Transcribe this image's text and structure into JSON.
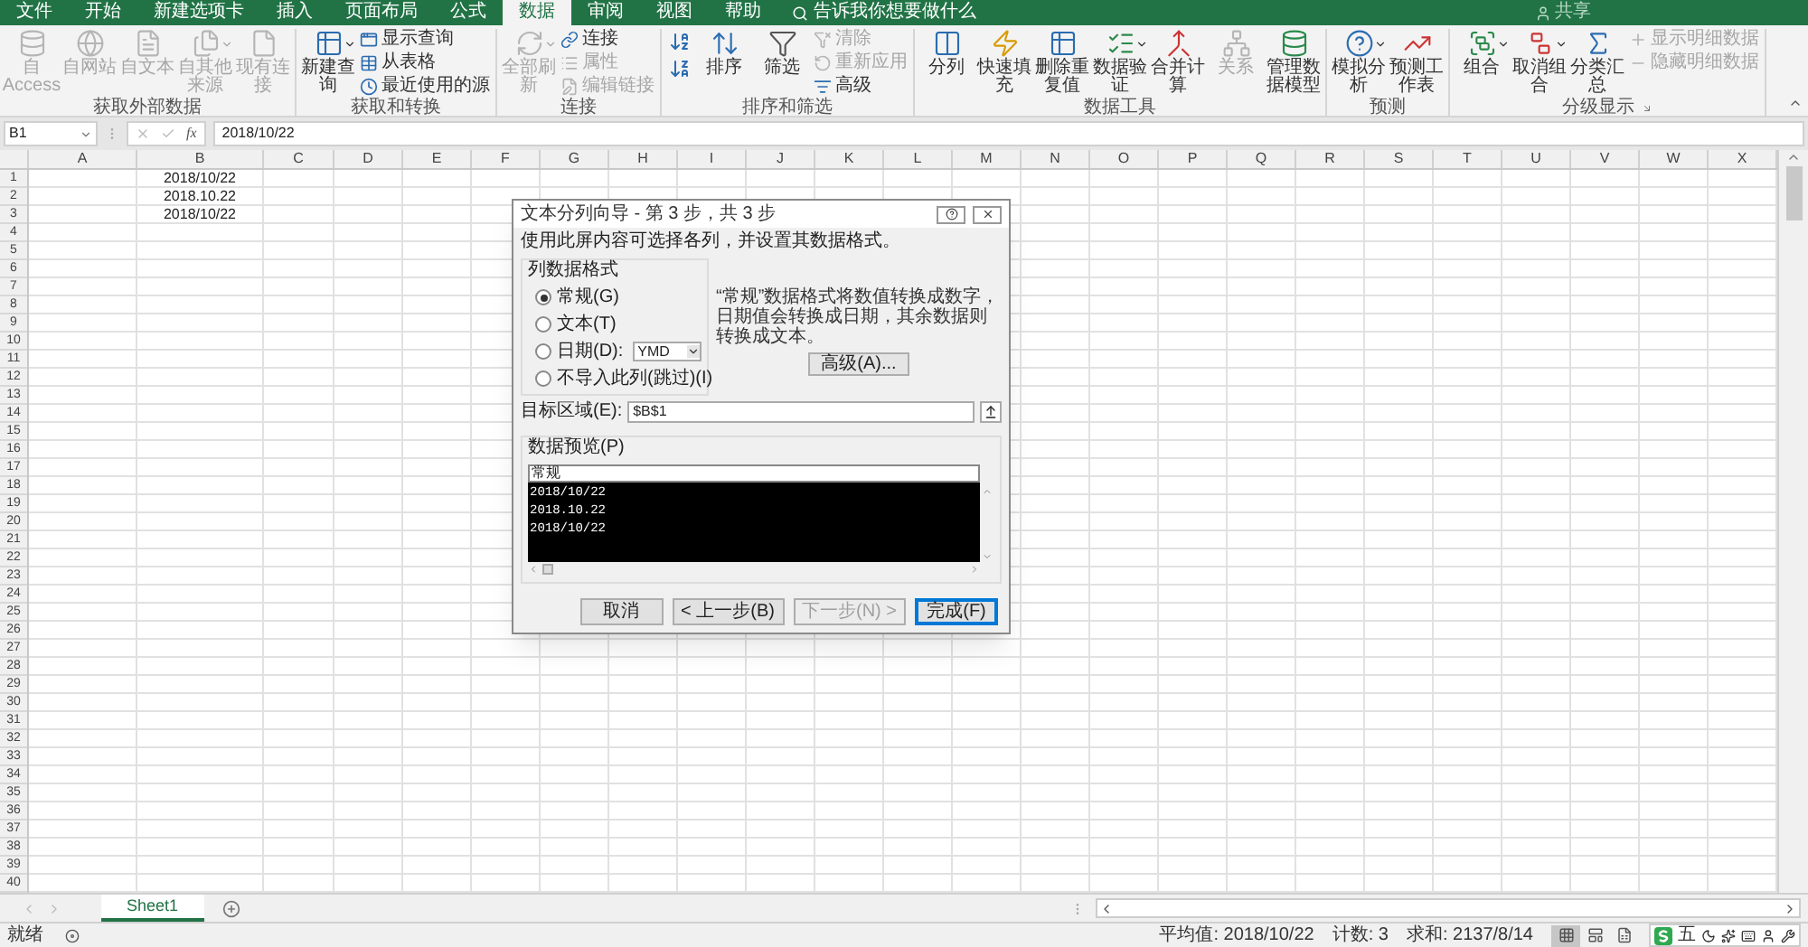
{
  "menu_tabs": [
    {
      "label": "文件",
      "selected": false
    },
    {
      "label": "开始",
      "selected": false
    },
    {
      "label": "新建选项卡",
      "selected": false
    },
    {
      "label": "插入",
      "selected": false
    },
    {
      "label": "页面布局",
      "selected": false
    },
    {
      "label": "公式",
      "selected": false
    },
    {
      "label": "数据",
      "selected": true
    },
    {
      "label": "审阅",
      "selected": false
    },
    {
      "label": "视图",
      "selected": false
    },
    {
      "label": "帮助",
      "selected": false
    }
  ],
  "tell_me": "告诉我你想要做什么",
  "share": "共享",
  "ribbon_groups": [
    {
      "label": "获取外部数据",
      "items": [
        {
          "kind": "large",
          "label": "自 Access",
          "disabled": true,
          "dropdown": false
        },
        {
          "kind": "large",
          "label": "自网站",
          "disabled": true,
          "dropdown": false
        },
        {
          "kind": "large",
          "label": "自文本",
          "disabled": true,
          "dropdown": false
        },
        {
          "kind": "large",
          "label": "自其他来源",
          "disabled": true,
          "dropdown": true
        },
        {
          "kind": "large",
          "label": "现有连接",
          "disabled": true,
          "dropdown": false
        }
      ]
    },
    {
      "label": "获取和转换",
      "items": [
        {
          "kind": "large",
          "label": "新建查询",
          "disabled": false,
          "dropdown": true
        },
        {
          "kind": "small",
          "label": "显示查询",
          "disabled": false
        },
        {
          "kind": "small",
          "label": "从表格",
          "disabled": false
        },
        {
          "kind": "small",
          "label": "最近使用的源",
          "disabled": false
        }
      ]
    },
    {
      "label": "连接",
      "items": [
        {
          "kind": "large",
          "label": "全部刷新",
          "disabled": true,
          "dropdown": true
        },
        {
          "kind": "small",
          "label": "连接",
          "disabled": false
        },
        {
          "kind": "small",
          "label": "属性",
          "disabled": true
        },
        {
          "kind": "small",
          "label": "编辑链接",
          "disabled": true
        }
      ]
    },
    {
      "label": "排序和筛选",
      "items": [
        {
          "kind": "icon",
          "disabled": false
        },
        {
          "kind": "icon",
          "disabled": false
        },
        {
          "kind": "large",
          "label": "排序",
          "disabled": false,
          "dropdown": false
        },
        {
          "kind": "large",
          "label": "筛选",
          "disabled": false,
          "dropdown": false
        },
        {
          "kind": "small",
          "label": "清除",
          "disabled": true
        },
        {
          "kind": "small",
          "label": "重新应用",
          "disabled": true
        },
        {
          "kind": "small",
          "label": "高级",
          "disabled": false
        }
      ]
    },
    {
      "label": "数据工具",
      "items": [
        {
          "kind": "large",
          "label": "分列",
          "disabled": false,
          "dropdown": false
        },
        {
          "kind": "large",
          "label": "快速填充",
          "disabled": false,
          "dropdown": false
        },
        {
          "kind": "large",
          "label": "删除重复值",
          "disabled": false,
          "dropdown": false
        },
        {
          "kind": "large",
          "label": "数据验证",
          "disabled": false,
          "dropdown": true
        },
        {
          "kind": "large",
          "label": "合并计算",
          "disabled": false,
          "dropdown": false
        },
        {
          "kind": "large",
          "label": "关系",
          "disabled": true,
          "dropdown": false
        },
        {
          "kind": "large",
          "label": "管理数据模型",
          "disabled": false,
          "dropdown": false
        }
      ]
    },
    {
      "label": "预测",
      "items": [
        {
          "kind": "large",
          "label": "模拟分析",
          "disabled": false,
          "dropdown": true
        },
        {
          "kind": "large",
          "label": "预测工作表",
          "disabled": false,
          "dropdown": false
        }
      ]
    },
    {
      "label": "分级显示",
      "items": [
        {
          "kind": "large",
          "label": "组合",
          "disabled": false,
          "dropdown": true
        },
        {
          "kind": "large",
          "label": "取消组合",
          "disabled": false,
          "dropdown": true
        },
        {
          "kind": "large",
          "label": "分类汇总",
          "disabled": false,
          "dropdown": false
        },
        {
          "kind": "small",
          "label": "显示明细数据",
          "disabled": true
        },
        {
          "kind": "small",
          "label": "隐藏明细数据",
          "disabled": true
        }
      ]
    }
  ],
  "name_box": "B1",
  "fx": "fx",
  "formula": "2018/10/22",
  "columns": [
    "A",
    "B",
    "C",
    "D",
    "E",
    "F",
    "G",
    "H",
    "I",
    "J",
    "K",
    "L",
    "M",
    "N",
    "O",
    "P",
    "Q",
    "R",
    "S",
    "T",
    "U",
    "V",
    "W",
    "X"
  ],
  "rows": [
    {
      "number": "1",
      "B": "2018/10/22"
    },
    {
      "number": "2",
      "B": "2018.10.22"
    },
    {
      "number": "3",
      "B": "2018/10/22"
    },
    {
      "number": "4"
    },
    {
      "number": "5"
    },
    {
      "number": "6"
    },
    {
      "number": "7"
    },
    {
      "number": "8"
    },
    {
      "number": "9"
    },
    {
      "number": "10"
    },
    {
      "number": "11"
    },
    {
      "number": "12"
    },
    {
      "number": "13"
    },
    {
      "number": "14"
    },
    {
      "number": "15"
    },
    {
      "number": "16"
    },
    {
      "number": "17"
    },
    {
      "number": "18"
    },
    {
      "number": "19"
    },
    {
      "number": "20"
    },
    {
      "number": "21"
    },
    {
      "number": "22"
    },
    {
      "number": "23"
    },
    {
      "number": "24"
    },
    {
      "number": "25"
    },
    {
      "number": "26"
    },
    {
      "number": "27"
    },
    {
      "number": "28"
    },
    {
      "number": "29"
    },
    {
      "number": "30"
    },
    {
      "number": "31"
    },
    {
      "number": "32"
    },
    {
      "number": "33"
    },
    {
      "number": "34"
    },
    {
      "number": "35"
    },
    {
      "number": "36"
    },
    {
      "number": "37"
    },
    {
      "number": "38"
    },
    {
      "number": "39"
    },
    {
      "number": "40"
    }
  ],
  "dialog": {
    "title": "文本分列向导 - 第 3 步，共 3 步",
    "instruction": "使用此屏内容可选择各列，并设置其数据格式。",
    "format_legend": "列数据格式",
    "formats": [
      {
        "kind": "plain",
        "label": "常规(G)",
        "selected": true
      },
      {
        "kind": "plain",
        "label": "文本(T)",
        "selected": false
      },
      {
        "kind": "date",
        "label": "日期(D):",
        "selected": false
      },
      {
        "kind": "plain",
        "label": "不导入此列(跳过)(I)",
        "selected": false
      }
    ],
    "date_order": "YMD",
    "description": "“常规”数据格式将数值转换成数字，日期值会转换成日期，其余数据则转换成文本。",
    "advanced_button": "高级(A)...",
    "destination_label": "目标区域(E):",
    "destination": "$B$1",
    "preview_legend": "数据预览(P)",
    "preview_header": "常规",
    "preview_lines": [
      "2018/10/22",
      "2018.10.22",
      "2018/10/22"
    ],
    "buttons": [
      {
        "label": "取消",
        "disabled": false,
        "default": false
      },
      {
        "label": "< 上一步(B)",
        "disabled": false,
        "default": false
      },
      {
        "label": "下一步(N) >",
        "disabled": true,
        "default": false
      },
      {
        "label": "完成(F)",
        "disabled": false,
        "default": true
      }
    ]
  },
  "sheets": [
    {
      "label": "Sheet1",
      "selected": true
    }
  ],
  "status": "就绪",
  "stats": [
    "平均值: 2018/10/22",
    "计数: 3",
    "求和: 2137/8/14"
  ],
  "views": [
    {
      "selected": true
    },
    {
      "selected": false
    },
    {
      "selected": false
    }
  ],
  "ime_mode": "五"
}
